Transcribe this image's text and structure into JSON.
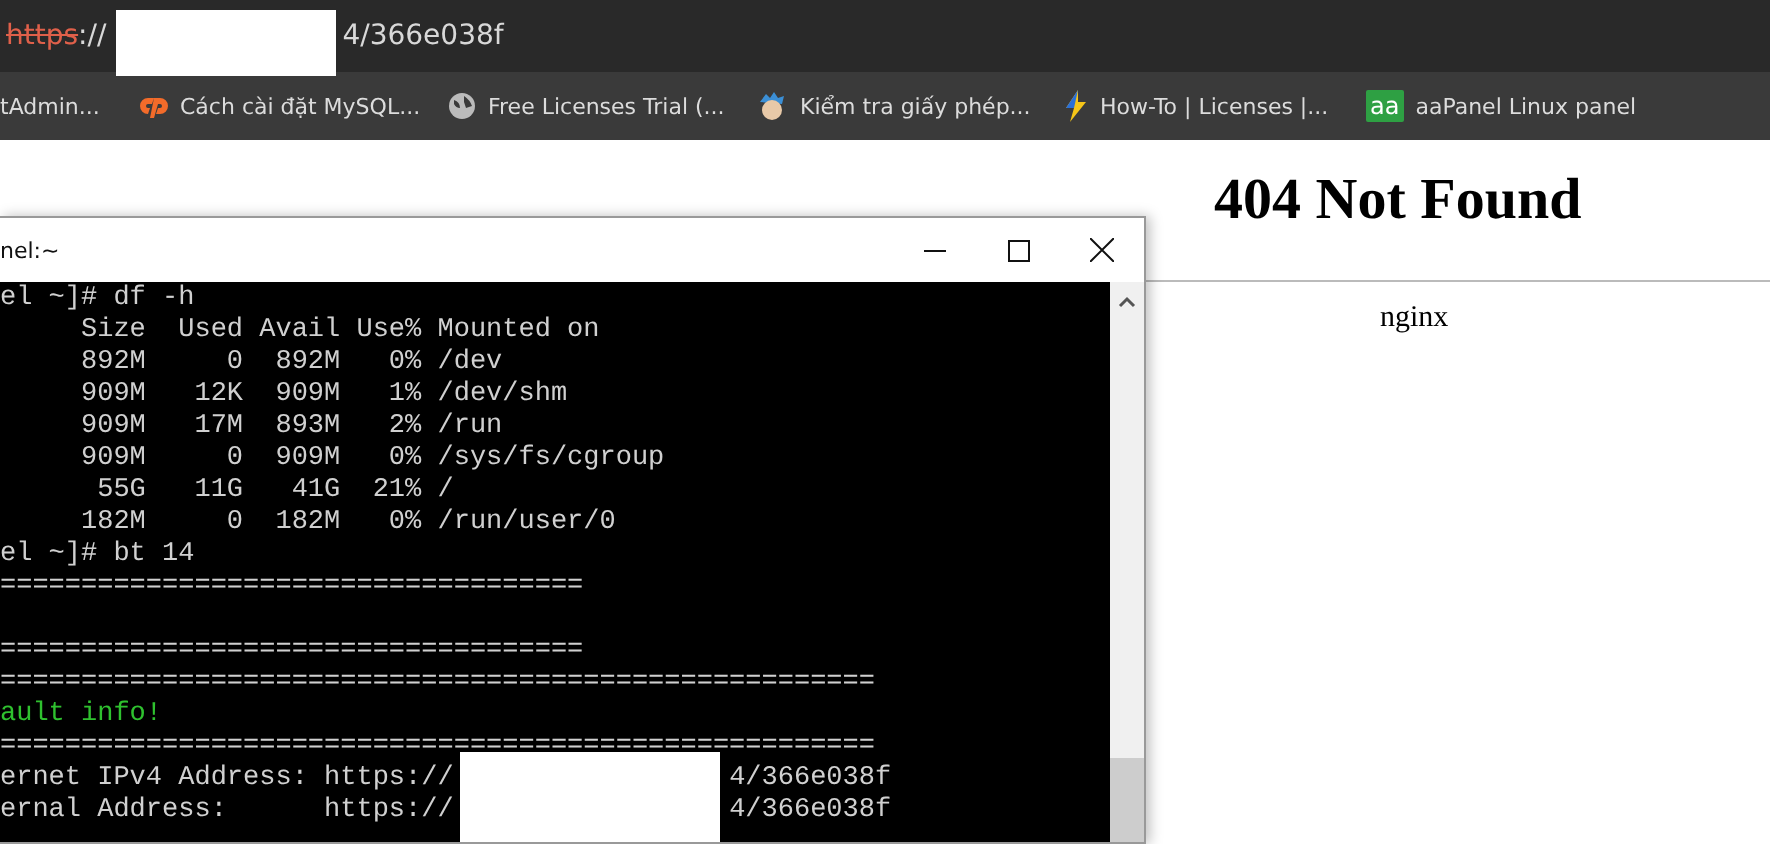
{
  "address_bar": {
    "scheme": "https",
    "rest_before": "://",
    "rest_after": "4/366e038f",
    "insecure": true
  },
  "bookmarks": [
    {
      "label": "tAdmin..."
    },
    {
      "label": "Cách cài đặt MySQL..."
    },
    {
      "label": "Free Licenses Trial (..."
    },
    {
      "label": "Kiểm tra giấy phép..."
    },
    {
      "label": "How-To | Licenses |..."
    },
    {
      "label": "aaPanel Linux panel",
      "icon_text": "aa"
    }
  ],
  "page": {
    "heading": "404 Not Found",
    "server": "nginx"
  },
  "terminal": {
    "title": "nel:~",
    "lines": [
      {
        "text": "el ~]# df -h"
      },
      {
        "text": "     Size  Used Avail Use% Mounted on"
      },
      {
        "text": "     892M     0  892M   0% /dev"
      },
      {
        "text": "     909M   12K  909M   1% /dev/shm"
      },
      {
        "text": "     909M   17M  893M   2% /run"
      },
      {
        "text": "     909M     0  909M   0% /sys/fs/cgroup"
      },
      {
        "text": "      55G   11G   41G  21% /"
      },
      {
        "text": "     182M     0  182M   0% /run/user/0"
      },
      {
        "text": "el ~]# bt 14"
      },
      {
        "text": "===================================="
      },
      {
        "kind": "blank"
      },
      {
        "text": "===================================="
      },
      {
        "text": "======================================================"
      },
      {
        "text": "ault info!",
        "kind": "success"
      },
      {
        "text": "======================================================"
      },
      {
        "text": "ernet IPv4 Address: https://",
        "after": "4/366e038f"
      },
      {
        "text": "ernal Address:      https://",
        "after": "4/366e038f"
      }
    ]
  }
}
